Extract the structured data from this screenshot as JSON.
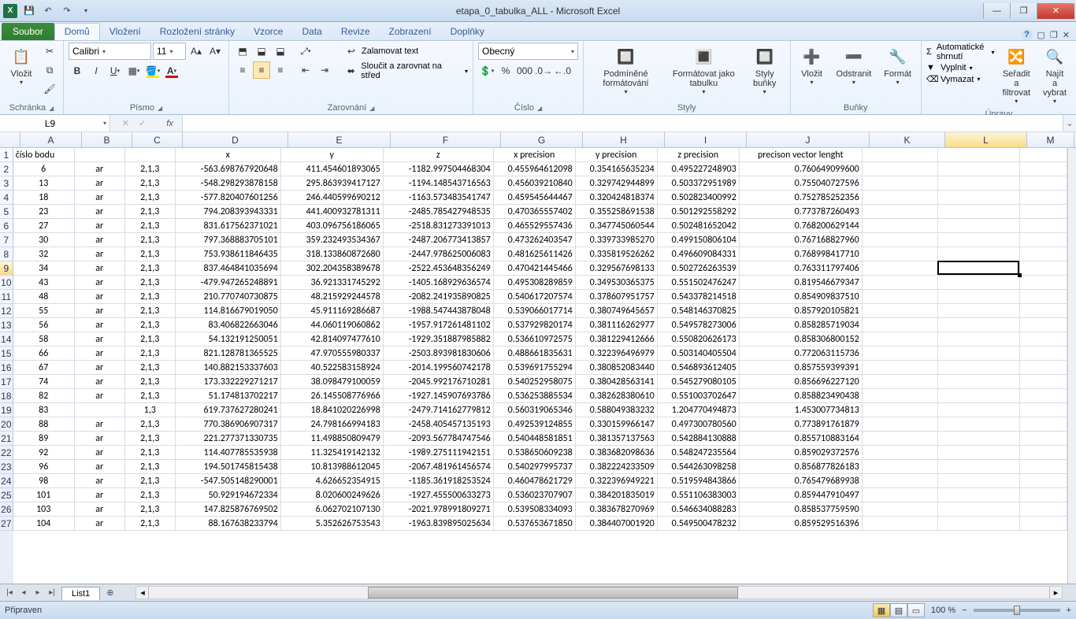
{
  "title": "etapa_0_tabulka_ALL - Microsoft Excel",
  "tabs": {
    "file": "Soubor",
    "list": [
      "Domů",
      "Vložení",
      "Rozložení stránky",
      "Vzorce",
      "Data",
      "Revize",
      "Zobrazení",
      "Doplňky"
    ],
    "active": 0
  },
  "ribbon": {
    "clipboard": {
      "paste": "Vložit",
      "label": "Schránka"
    },
    "font": {
      "name": "Calibri",
      "size": "11",
      "label": "Písmo"
    },
    "align": {
      "wrap": "Zalamovat text",
      "merge": "Sloučit a zarovnat na střed",
      "label": "Zarovnání"
    },
    "number": {
      "format": "Obecný",
      "label": "Číslo"
    },
    "styles": {
      "cond": "Podmíněné formátování",
      "table": "Formátovat jako tabulku",
      "cell": "Styly buňky",
      "label": "Styly"
    },
    "cells": {
      "insert": "Vložit",
      "delete": "Odstranit",
      "format": "Formát",
      "label": "Buňky"
    },
    "editing": {
      "autosum": "Automatické shrnutí",
      "fill": "Vyplnit",
      "clear": "Vymazat",
      "sort": "Seřadit a filtrovat",
      "find": "Najít a vybrat",
      "label": "Úpravy"
    }
  },
  "namebox": "L9",
  "columns": [
    "A",
    "B",
    "C",
    "D",
    "E",
    "F",
    "G",
    "H",
    "I",
    "J",
    "K",
    "L",
    "M"
  ],
  "headers": [
    "číslo bodu",
    "",
    "",
    "x",
    "y",
    "z",
    "x  precision",
    "y precision",
    "z precision",
    "precison vector lenght",
    "",
    "",
    ""
  ],
  "rows": [
    [
      "6",
      "ar",
      "2,1,3",
      "-563.698767920648",
      "411.454601893065",
      "-1182.997504468304",
      "0.455964612098",
      "0.354165635234",
      "0.495227248903",
      "0.760649099600"
    ],
    [
      "13",
      "ar",
      "2,1,3",
      "-548.298293878158",
      "295.863939417127",
      "-1194.148543716563",
      "0.456039210840",
      "0.329742944899",
      "0.503372951989",
      "0.755040727596"
    ],
    [
      "18",
      "ar",
      "2,1,3",
      "-577.820407601256",
      "246.440599690212",
      "-1163.573483541747",
      "0.459545644467",
      "0.320424818374",
      "0.502823400992",
      "0.752785252356"
    ],
    [
      "23",
      "ar",
      "2,1,3",
      "794.208393943331",
      "441.400932781311",
      "-2485.785427948535",
      "0.470365557402",
      "0.355258691538",
      "0.501292558292",
      "0.773787260493"
    ],
    [
      "27",
      "ar",
      "2,1,3",
      "831.617562371021",
      "403.096756186065",
      "-2518.831273391013",
      "0.465529557436",
      "0.347745060544",
      "0.502481652042",
      "0.768200629144"
    ],
    [
      "30",
      "ar",
      "2,1,3",
      "797.368883705101",
      "359.232493534367",
      "-2487.206773413857",
      "0.473262403547",
      "0.339733985270",
      "0.499150806104",
      "0.767168827960"
    ],
    [
      "32",
      "ar",
      "2,1,3",
      "753.938611846435",
      "318.133860872680",
      "-2447.978625006083",
      "0.481625611426",
      "0.335819526262",
      "0.496609084331",
      "0.768998417710"
    ],
    [
      "34",
      "ar",
      "2,1,3",
      "837.464841035694",
      "302.204358389678",
      "-2522.453648356249",
      "0.470421445466",
      "0.329567698133",
      "0.502726263539",
      "0.763311797406"
    ],
    [
      "43",
      "ar",
      "2,1,3",
      "-479.947265248891",
      "36.921331745292",
      "-1405.168929636574",
      "0.495308289859",
      "0.349530365375",
      "0.551502476247",
      "0.819546679347"
    ],
    [
      "48",
      "ar",
      "2,1,3",
      "210.770740730875",
      "48.215929244578",
      "-2082.241935890825",
      "0.540617207574",
      "0.378607951757",
      "0.543378214518",
      "0.854909837510"
    ],
    [
      "55",
      "ar",
      "2,1,3",
      "114.816679019050",
      "45.911169286687",
      "-1988.547443878048",
      "0.539066017714",
      "0.380749645657",
      "0.548146370825",
      "0.857920105821"
    ],
    [
      "56",
      "ar",
      "2,1,3",
      "83.406822663046",
      "44.060119060862",
      "-1957.917261481102",
      "0.537929820174",
      "0.381116262977",
      "0.549578273006",
      "0.858285719034"
    ],
    [
      "58",
      "ar",
      "2,1,3",
      "54.132191250051",
      "42.814097477610",
      "-1929.351887985882",
      "0.536610972575",
      "0.381229412666",
      "0.550820626173",
      "0.858306800152"
    ],
    [
      "66",
      "ar",
      "2,1,3",
      "821.128781365525",
      "47.970555980337",
      "-2503.893981830606",
      "0.488661835631",
      "0.322396496979",
      "0.503140405504",
      "0.772063115736"
    ],
    [
      "67",
      "ar",
      "2,1,3",
      "140.882153337603",
      "40.522583158924",
      "-2014.199560742178",
      "0.539691755294",
      "0.380852083440",
      "0.546893612405",
      "0.857559399391"
    ],
    [
      "74",
      "ar",
      "2,1,3",
      "173.332229271217",
      "38.098479100059",
      "-2045.992176710281",
      "0.540252958075",
      "0.380428563141",
      "0.545279080105",
      "0.856696227120"
    ],
    [
      "82",
      "ar",
      "2,1,3",
      "51.174813702217",
      "26.145508776966",
      "-1927.145907693786",
      "0.536253885534",
      "0.382628380610",
      "0.551003702647",
      "0.858823490438"
    ],
    [
      "83",
      "",
      "1,3",
      "619.737627280241",
      "18.841020226998",
      "-2479.714162779812",
      "0.560319065346",
      "0.588049383232",
      "1.204770494873",
      "1.453007734813"
    ],
    [
      "88",
      "ar",
      "2,1,3",
      "770.386906907317",
      "24.798166994183",
      "-2458.405457135193",
      "0.492539124855",
      "0.330159966147",
      "0.497300780560",
      "0.773891761879"
    ],
    [
      "89",
      "ar",
      "2,1,3",
      "221.277371330735",
      "11.498850809479",
      "-2093.567784747546",
      "0.540448581851",
      "0.381357137563",
      "0.542884130888",
      "0.855710883164"
    ],
    [
      "92",
      "ar",
      "2,1,3",
      "114.407785535938",
      "11.325419142132",
      "-1989.275111942151",
      "0.538650609238",
      "0.383682098636",
      "0.548247235564",
      "0.859029372576"
    ],
    [
      "96",
      "ar",
      "2,1,3",
      "194.501745815438",
      "10.813988612045",
      "-2067.481961456574",
      "0.540297995737",
      "0.382224233509",
      "0.544263098258",
      "0.856877826183"
    ],
    [
      "98",
      "ar",
      "2,1,3",
      "-547.505148290001",
      "4.626652354915",
      "-1185.361918253524",
      "0.460478621729",
      "0.322396949221",
      "0.519594843866",
      "0.765479689938"
    ],
    [
      "101",
      "ar",
      "2,1,3",
      "50.929194672334",
      "8.020600249626",
      "-1927.455500633273",
      "0.536023707907",
      "0.384201835019",
      "0.551106383003",
      "0.859447910497"
    ],
    [
      "103",
      "ar",
      "2,1,3",
      "147.825876769502",
      "6.062702107130",
      "-2021.978991809271",
      "0.539508334093",
      "0.383678270969",
      "0.546634088283",
      "0.858537759590"
    ],
    [
      "104",
      "ar",
      "2,1,3",
      "88.167638233794",
      "5.352626753543",
      "-1963.839895025634",
      "0.537653671850",
      "0.384407001920",
      "0.549500478232",
      "0.859529516396"
    ]
  ],
  "sheet": {
    "name": "List1"
  },
  "status": {
    "ready": "Připraven",
    "zoom": "100 %"
  },
  "selection": {
    "col": "L",
    "row": 9
  }
}
